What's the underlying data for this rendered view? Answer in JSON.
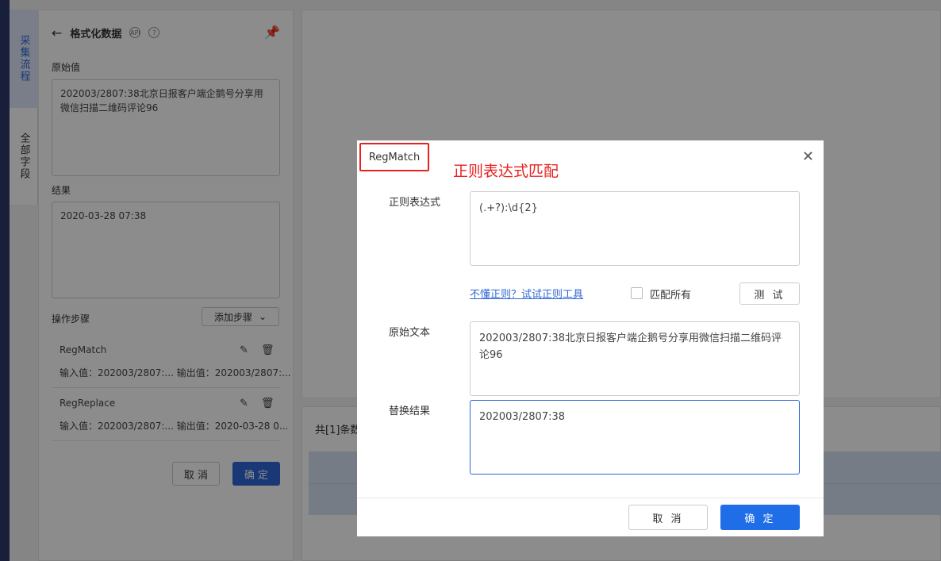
{
  "sidebar_tabs": [
    "采集流程",
    "全部字段"
  ],
  "panel": {
    "title": "格式化数据",
    "api_icon": "API",
    "help_icon": "?",
    "raw_label": "原始值",
    "raw_value": "202003/2807:38北京日报客户端企鹅号分享用微信扫描二维码评论96",
    "result_label": "结果",
    "result_value": "2020-03-28 07:38",
    "steps_label": "操作步骤",
    "add_step": "添加步骤",
    "steps": [
      {
        "name": "RegMatch",
        "desc": "输入值：202003/2807:...  输出值：202003/2807:..."
      },
      {
        "name": "RegReplace",
        "desc": "输入值：202003/2807:...  输出值：2020-03-28 0..."
      }
    ],
    "cancel": "取 消",
    "ok": "确 定"
  },
  "bottom": {
    "count_text": "共[1]条数"
  },
  "modal": {
    "title": "RegMatch",
    "annotation": "正则表达式匹配",
    "regex_label": "正则表达式",
    "regex_value": "(.+?):\\d{2}",
    "help_link": "不懂正则？试试正则工具",
    "match_all": "匹配所有",
    "test": "测 试",
    "source_label": "原始文本",
    "source_value": "202003/2807:38北京日报客户端企鹅号分享用微信扫描二维码评论96",
    "result_label": "替换结果",
    "result_value": "202003/2807:38",
    "cancel": "取 消",
    "ok": "确 定"
  },
  "colors": {
    "accent": "#2f66d6",
    "annotation": "#e8211f"
  }
}
